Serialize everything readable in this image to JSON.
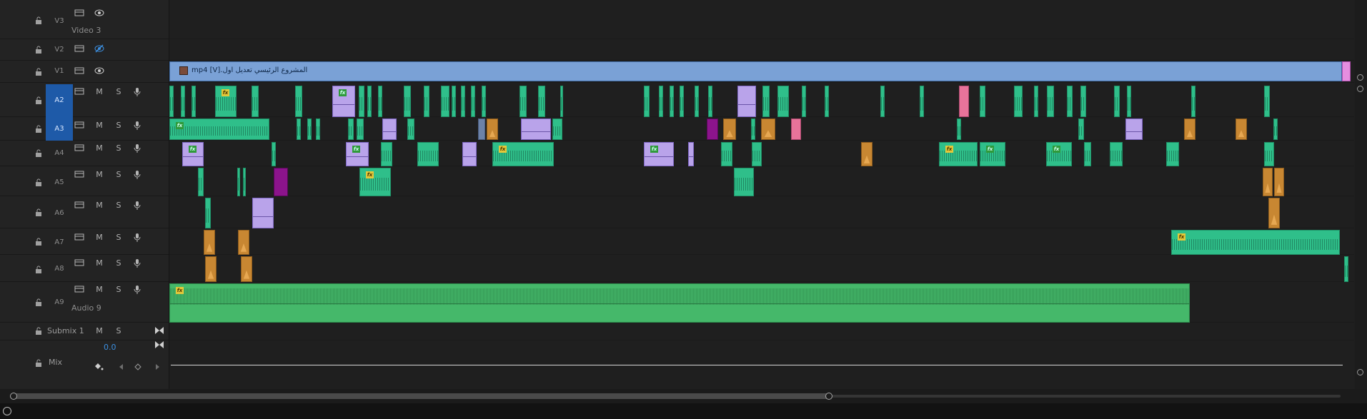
{
  "tracks": {
    "v3": {
      "name": "V3",
      "subtitle": "Video 3"
    },
    "v2": {
      "name": "V2"
    },
    "v1": {
      "name": "V1"
    },
    "a2": {
      "name": "A2",
      "m": "M",
      "s": "S"
    },
    "a3": {
      "name": "A3",
      "m": "M",
      "s": "S"
    },
    "a4": {
      "name": "A4",
      "m": "M",
      "s": "S"
    },
    "a5": {
      "name": "A5",
      "m": "M",
      "s": "S"
    },
    "a6": {
      "name": "A6",
      "m": "M",
      "s": "S"
    },
    "a7": {
      "name": "A7",
      "m": "M",
      "s": "S"
    },
    "a8": {
      "name": "A8",
      "m": "M",
      "s": "S"
    },
    "a9": {
      "name": "A9",
      "subtitle": "Audio 9",
      "m": "M",
      "s": "S"
    },
    "submix": {
      "name": "Submix 1",
      "m": "M",
      "s": "S"
    },
    "mix": {
      "name": "Mix",
      "value": "0.0"
    }
  },
  "v1_clip_label": "المشروع الرئيسي تعديل اول.mp4 [V]",
  "fx_label": "fx",
  "colors": {
    "video_clip": "#7aa1d6",
    "audio_clip": "#2fbf8a",
    "music_clip": "#45b86a",
    "purple_clip": "#b9a3ea",
    "orange_clip": "#c88732",
    "magenta_clip": "#8c148c",
    "pink_clip": "#e8739a",
    "target_track": "#1e5aa8"
  },
  "icons": [
    "lock-icon",
    "film-icon",
    "eye-icon",
    "eye-disabled-icon",
    "mic-icon",
    "bowtie-icon",
    "keyframe-icon"
  ]
}
